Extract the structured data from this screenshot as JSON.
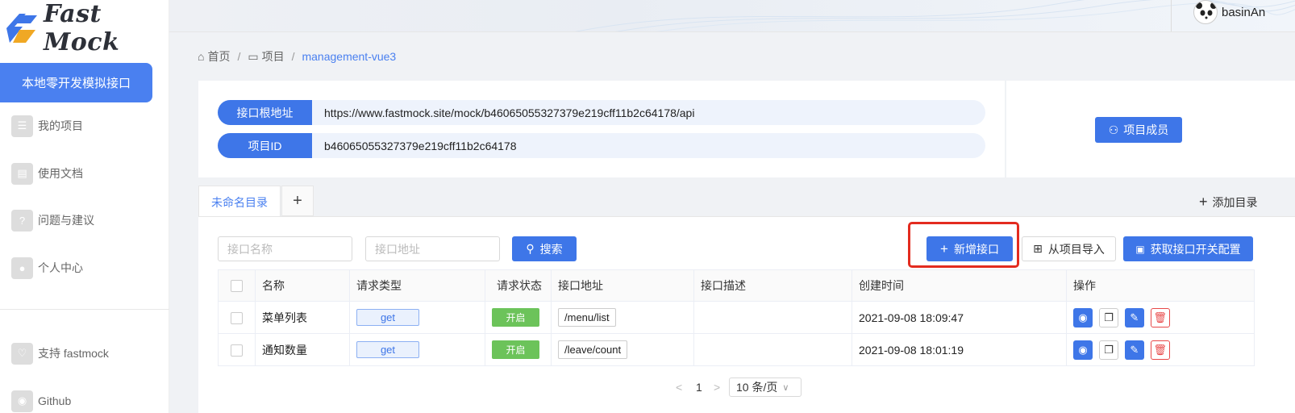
{
  "app": {
    "logo_text": "Fast Mock",
    "user_name": "basinAn"
  },
  "sidebar": {
    "active_item": "本地零开发模拟接口",
    "items": [
      {
        "label": "我的项目",
        "icon": "list-icon"
      },
      {
        "label": "使用文档",
        "icon": "document-icon"
      },
      {
        "label": "问题与建议",
        "icon": "question-icon"
      },
      {
        "label": "个人中心",
        "icon": "user-icon"
      }
    ],
    "bottom_items": [
      {
        "label": "支持 fastmock",
        "icon": "heart-icon"
      },
      {
        "label": "Github",
        "icon": "github-icon"
      }
    ]
  },
  "breadcrumb": {
    "home": "首页",
    "project": "项目",
    "current": "management-vue3"
  },
  "info": {
    "root_label": "接口根地址",
    "root_value": "https://www.fastmock.site/mock/b46065055327379e219cff11b2c64178/api",
    "id_label": "项目ID",
    "id_value": "b46065055327379e219cff11b2c64178",
    "members_button": "项目成员"
  },
  "tabs": {
    "active": "未命名目录",
    "add_symbol": "+",
    "add_dir": "添加目录"
  },
  "toolbar": {
    "name_placeholder": "接口名称",
    "path_placeholder": "接口地址",
    "search": "搜索",
    "add_api": "新增接口",
    "import": "从项目导入",
    "switch_config": "获取接口开关配置"
  },
  "table": {
    "headers": [
      "名称",
      "请求类型",
      "请求状态",
      "接口地址",
      "接口描述",
      "创建时间",
      "操作"
    ],
    "rows": [
      {
        "name": "菜单列表",
        "method": "get",
        "status": "开启",
        "path": "/menu/list",
        "desc": "",
        "created": "2021-09-08 18:09:47"
      },
      {
        "name": "通知数量",
        "method": "get",
        "status": "开启",
        "path": "/leave/count",
        "desc": "",
        "created": "2021-09-08 18:01:19"
      }
    ]
  },
  "pager": {
    "prev": "<",
    "page": "1",
    "next": ">",
    "size": "10 条/页"
  },
  "colors": {
    "primary": "#3e76e8",
    "status_on": "#6cc35a",
    "highlight": "#e32b1f"
  }
}
